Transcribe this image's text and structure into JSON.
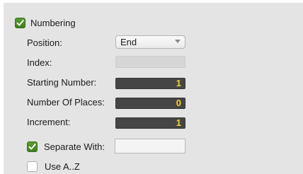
{
  "numbering": {
    "label": "Numbering",
    "checked": true
  },
  "position": {
    "label": "Position:",
    "value": "End"
  },
  "index": {
    "label": "Index:",
    "value": ""
  },
  "starting_number": {
    "label": "Starting Number:",
    "value": "1"
  },
  "number_of_places": {
    "label": "Number Of Places:",
    "value": "0"
  },
  "increment": {
    "label": "Increment:",
    "value": "1"
  },
  "separate_with": {
    "label": "Separate With:",
    "checked": true,
    "value": ""
  },
  "use_az": {
    "label": "Use A..Z",
    "checked": false
  },
  "colors": {
    "checkbox_checked": "#4a8a24",
    "number_text": "#f3d13a",
    "number_field_bg": "#454545",
    "panel_bg": "#e4e4e4"
  }
}
